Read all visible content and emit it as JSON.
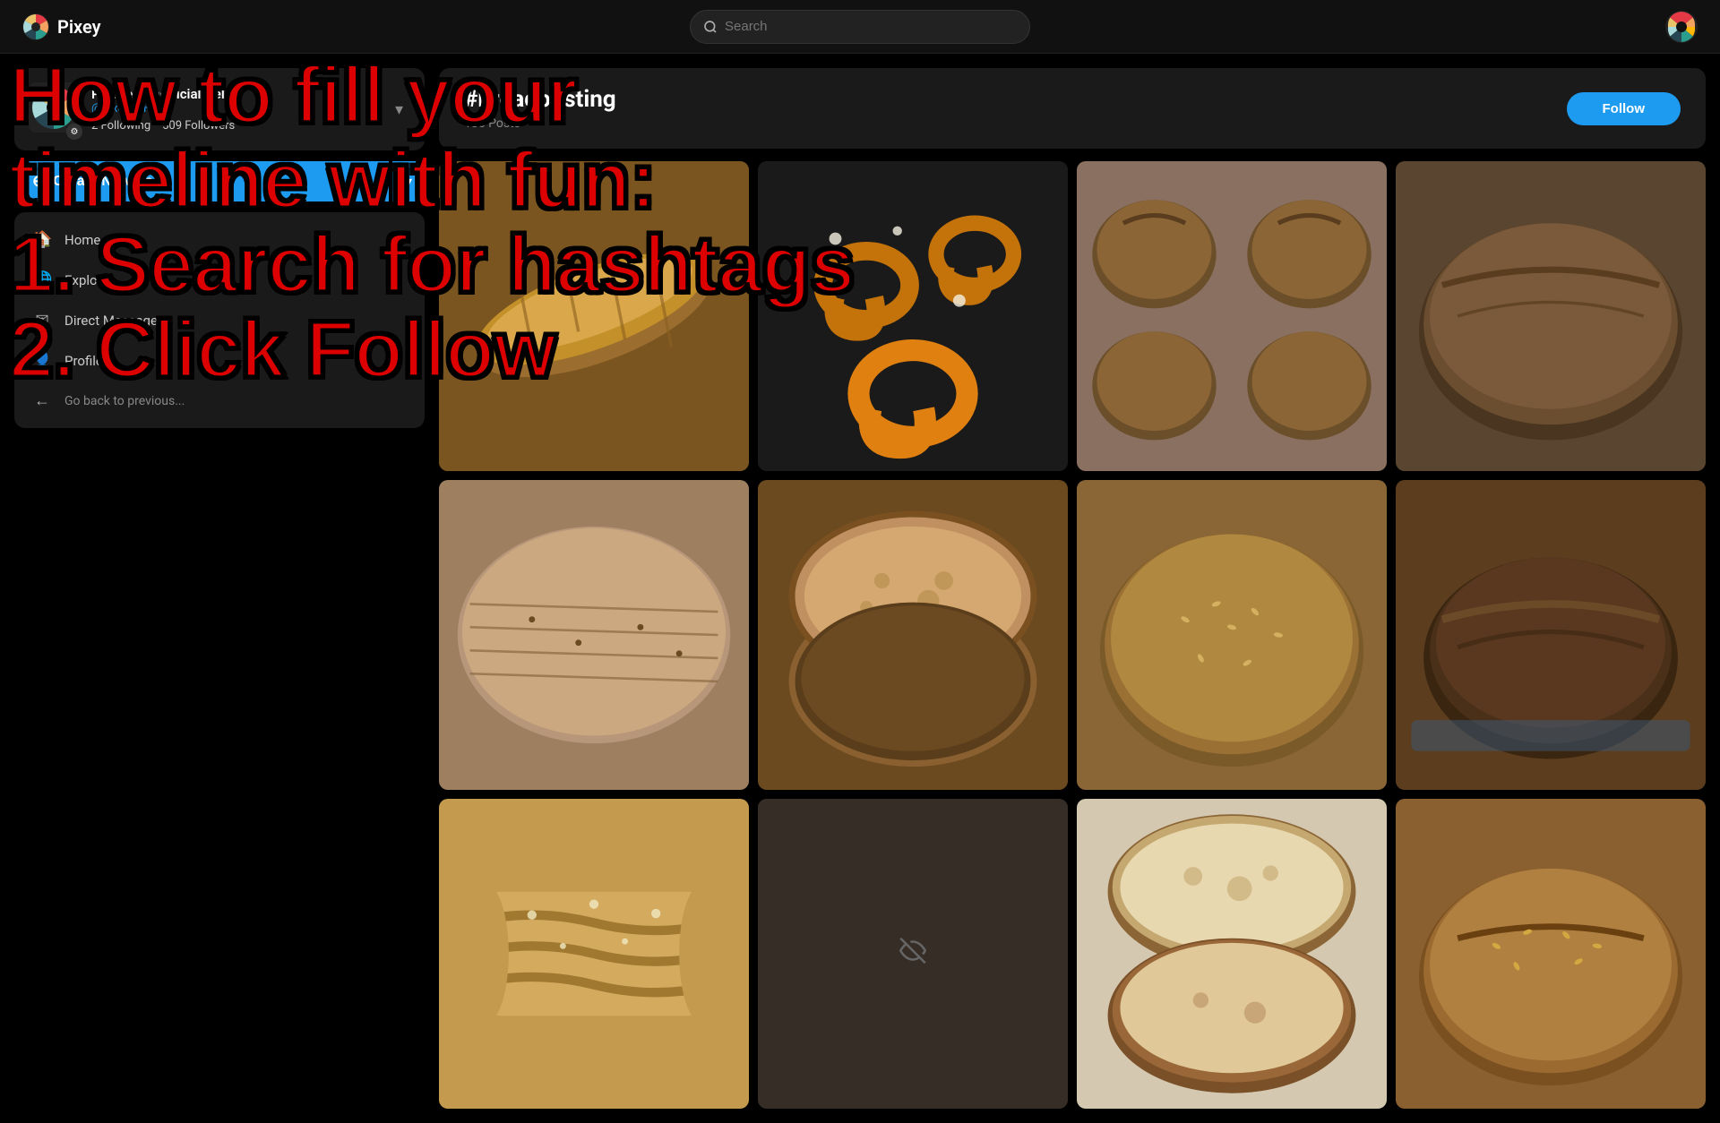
{
  "app": {
    "brand_name": "Pixey"
  },
  "topnav": {
    "search_placeholder": "Search"
  },
  "sidebar": {
    "profile": {
      "name": "Pixelfed Unofficial Help",
      "handle": "@PixelfedHelp",
      "following_count": "2",
      "following_label": "Following",
      "followers_count": "509",
      "followers_label": "Followers"
    },
    "create_post_label": "Create New Post",
    "nav_items": [
      {
        "icon": "🏠",
        "label": "Home"
      },
      {
        "icon": "🌐",
        "label": "Explore"
      },
      {
        "icon": "✉",
        "label": "Direct Messages"
      },
      {
        "icon": "👤",
        "label": "Profile"
      },
      {
        "icon": "←",
        "label": "Go back to previous"
      }
    ]
  },
  "hashtag": {
    "title": "#breadposting",
    "posts_count": "136",
    "posts_label": "Posts",
    "follow_label": "Follow"
  },
  "overlay": {
    "line1": "How to fill your",
    "line2": "timeline with fun:",
    "line3": "1. Search for hashtags",
    "line4": "2. Click Follow"
  },
  "grid": {
    "items": [
      {
        "id": 1,
        "color": "#8B6914",
        "type": "baguette"
      },
      {
        "id": 2,
        "color": "#c4720a",
        "type": "pretzels"
      },
      {
        "id": 3,
        "color": "#6b4e2a",
        "type": "sourdough_rolls"
      },
      {
        "id": 4,
        "color": "#7a5c3a",
        "type": "dark_bread"
      },
      {
        "id": 5,
        "color": "#9e8060",
        "type": "focaccia"
      },
      {
        "id": 6,
        "color": "#6b4a20",
        "type": "sliced_sourdough"
      },
      {
        "id": 7,
        "color": "#8a6535",
        "type": "seeded_loaf"
      },
      {
        "id": 8,
        "color": "#5c3d1e",
        "type": "burnt_loaf"
      },
      {
        "id": 9,
        "color": "#c49a4e",
        "type": "braided_bread"
      },
      {
        "id": 10,
        "color": "#4a3728",
        "type": "dark_video"
      },
      {
        "id": 11,
        "color": "#d4c8b0",
        "type": "white_bread"
      },
      {
        "id": 12,
        "color": "#8b6030",
        "type": "seeded_loaf2"
      }
    ]
  }
}
